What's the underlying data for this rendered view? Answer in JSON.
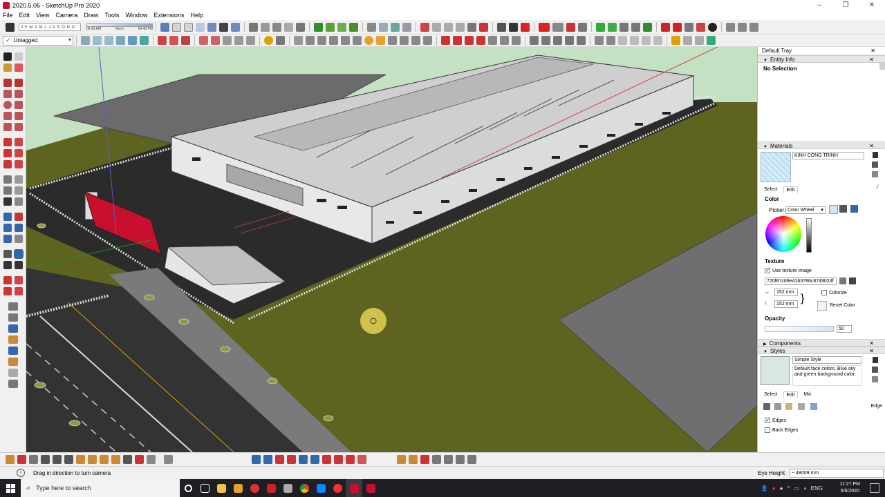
{
  "window": {
    "title": "2020.5.06 - SketchUp Pro 2020",
    "minimize": "–",
    "maximize": "❐",
    "close": "✕"
  },
  "menu": [
    "File",
    "Edit",
    "View",
    "Camera",
    "Draw",
    "Tools",
    "Window",
    "Extensions",
    "Help"
  ],
  "shadows": {
    "months": "J F M A M J J A S O N D",
    "time_start": "06:43 AM",
    "time_mid": "Noon",
    "time_end": "04:45 PM"
  },
  "tag_selector": {
    "value": "Untagged",
    "check": "✓",
    "arrow": "▾"
  },
  "tray": {
    "title": "Default Tray",
    "close": "✕",
    "entity_info": {
      "header": "Entity Info",
      "selection": "No Selection",
      "close": "✕"
    },
    "materials": {
      "header": "Materials",
      "close": "✕",
      "name": "KINH CONG TRINH",
      "tabs": [
        "Select",
        "Edit"
      ],
      "color_label": "Color",
      "picker_label": "Picker:",
      "picker_value": "Color Wheel",
      "texture_label": "Texture",
      "use_texture": "Use texture image",
      "texture_file": "720f87c69e4163786c874902df",
      "width": "152 mm",
      "height": "152 mm",
      "colorize": "Colorize",
      "reset_color": "Reset Color",
      "opacity_label": "Opacity",
      "opacity_value": "50"
    },
    "components": {
      "header": "Components",
      "close": "✕"
    },
    "styles": {
      "header": "Styles",
      "close": "✕",
      "name": "Simple Style",
      "description": "Default face colors. Blue sky and green background color.",
      "tabs": [
        "Select",
        "Edit",
        "Mix"
      ],
      "edge_label": "Edge",
      "edges": "Edges",
      "back_edges": "Back Edges"
    }
  },
  "status": {
    "message": "Drag in direction to turn camera",
    "measure_label": "Eye Height",
    "measure_value": "~ 48009 mm"
  },
  "taskbar": {
    "search_placeholder": "Type here to search",
    "time": "11:27 PM",
    "date": "5/6/2020"
  },
  "colors": {
    "ground": "#5e6420",
    "sky": "#c5e1c4",
    "accent_red": "#c8102e",
    "taskbar": "#1f1f23",
    "tray_header": "#e6e6e6"
  }
}
